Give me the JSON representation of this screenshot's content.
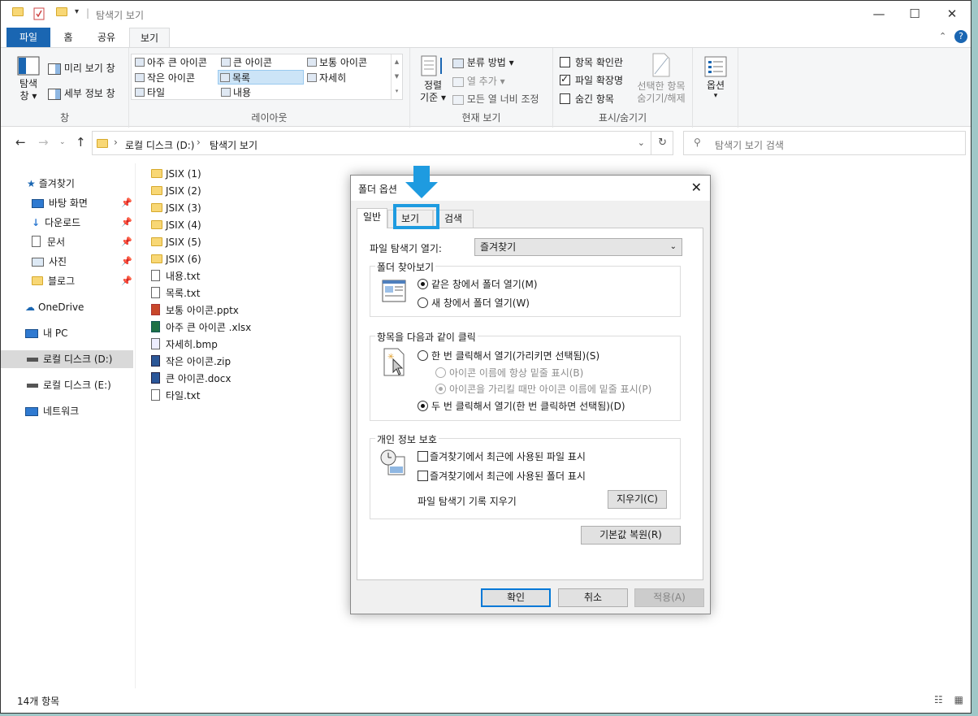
{
  "window": {
    "title": "탐색기 보기",
    "controls": {
      "minimize": "—",
      "maximize": "☐",
      "close": "✕"
    }
  },
  "ribbon": {
    "tabs": [
      {
        "label": "파일",
        "active": false
      },
      {
        "label": "홈",
        "active": false
      },
      {
        "label": "공유",
        "active": false
      },
      {
        "label": "보기",
        "active": true
      }
    ],
    "pane_group": {
      "nav_pane": "탐색",
      "nav_pane2": "창",
      "preview": "미리 보기 창",
      "details": "세부 정보 창",
      "label": "창"
    },
    "layout_group": {
      "items": [
        "아주 큰 아이콘",
        "큰 아이콘",
        "보통 아이콘",
        "작은 아이콘",
        "목록",
        "자세히",
        "타일",
        "내용"
      ],
      "selected": "목록",
      "label": "레이아웃"
    },
    "current_view": {
      "sort": "정렬",
      "sort2": "기준",
      "group_by": "분류 방법",
      "add_column": "열 추가",
      "fit_columns": "모든 열 너비 조정",
      "label": "현재 보기"
    },
    "show_hide": {
      "item_checkboxes": "항목 확인란",
      "file_ext": "파일 확장명",
      "hidden_items": "숨긴 항목",
      "hide_selected": "선택한 항목",
      "hide_selected2": "숨기기/해제",
      "label": "표시/숨기기"
    },
    "options": {
      "label": "옵션"
    }
  },
  "address": {
    "path": [
      "로컬 디스크 (D:)",
      "탐색기 보기"
    ],
    "search_placeholder": "탐색기 보기 검색"
  },
  "nav_pane": {
    "quick_access": "즐겨찾기",
    "pinned": [
      "바탕 화면",
      "다운로드",
      "문서",
      "사진",
      "블로그"
    ],
    "onedrive": "OneDrive",
    "this_pc": "내 PC",
    "drive_d": "로컬 디스크 (D:)",
    "drive_e": "로컬 디스크 (E:)",
    "network": "네트워크"
  },
  "files": [
    {
      "name": "JSIX (1)",
      "icon": "folder"
    },
    {
      "name": "JSIX (2)",
      "icon": "folder"
    },
    {
      "name": "JSIX (3)",
      "icon": "folder"
    },
    {
      "name": "JSIX (4)",
      "icon": "folder"
    },
    {
      "name": "JSIX (5)",
      "icon": "folder"
    },
    {
      "name": "JSIX (6)",
      "icon": "folder"
    },
    {
      "name": "내용.txt",
      "icon": "txt"
    },
    {
      "name": "목록.txt",
      "icon": "txt"
    },
    {
      "name": "보통 아이콘.pptx",
      "icon": "pptx"
    },
    {
      "name": "아주 큰 아이콘 .xlsx",
      "icon": "xlsx"
    },
    {
      "name": "자세히.bmp",
      "icon": "bmp"
    },
    {
      "name": "작은 아이콘.zip",
      "icon": "zip"
    },
    {
      "name": "큰 아이콘.docx",
      "icon": "docx"
    },
    {
      "name": "타일.txt",
      "icon": "txt"
    }
  ],
  "status": {
    "count": "14개 항목"
  },
  "dialog": {
    "title": "폴더 옵션",
    "tabs": [
      {
        "label": "일반",
        "active": true
      },
      {
        "label": "보기",
        "active": false
      },
      {
        "label": "검색",
        "active": false
      }
    ],
    "open_explorer_label": "파일 탐색기 열기:",
    "open_explorer_value": "즐겨찾기",
    "browse": {
      "legend": "폴더 찾아보기",
      "same_window": "같은 창에서 폴더 열기(M)",
      "new_window": "새 창에서 폴더 열기(W)",
      "selected": "same_window"
    },
    "click": {
      "legend": "항목을 다음과 같이 클릭",
      "single": "한 번 클릭해서 열기(가리키면 선택됨)(S)",
      "underline_always": "아이콘 이름에 항상 밑줄 표시(B)",
      "underline_hover": "아이콘을 가리킬 때만 아이콘 이름에 밑줄 표시(P)",
      "double": "두 번 클릭해서 열기(한 번 클릭하면 선택됨)(D)",
      "selected": "double"
    },
    "privacy": {
      "legend": "개인 정보 보호",
      "recent_files": "즐겨찾기에서 최근에 사용된 파일 표시",
      "recent_folders": "즐겨찾기에서 최근에 사용된 폴더 표시",
      "clear_history_label": "파일 탐색기 기록 지우기",
      "clear_button": "지우기(C)"
    },
    "restore_defaults": "기본값 복원(R)",
    "ok": "확인",
    "cancel": "취소",
    "apply": "적용(A)"
  },
  "colors": {
    "accent": "#1a66b2",
    "highlight": "#1e9be0"
  }
}
